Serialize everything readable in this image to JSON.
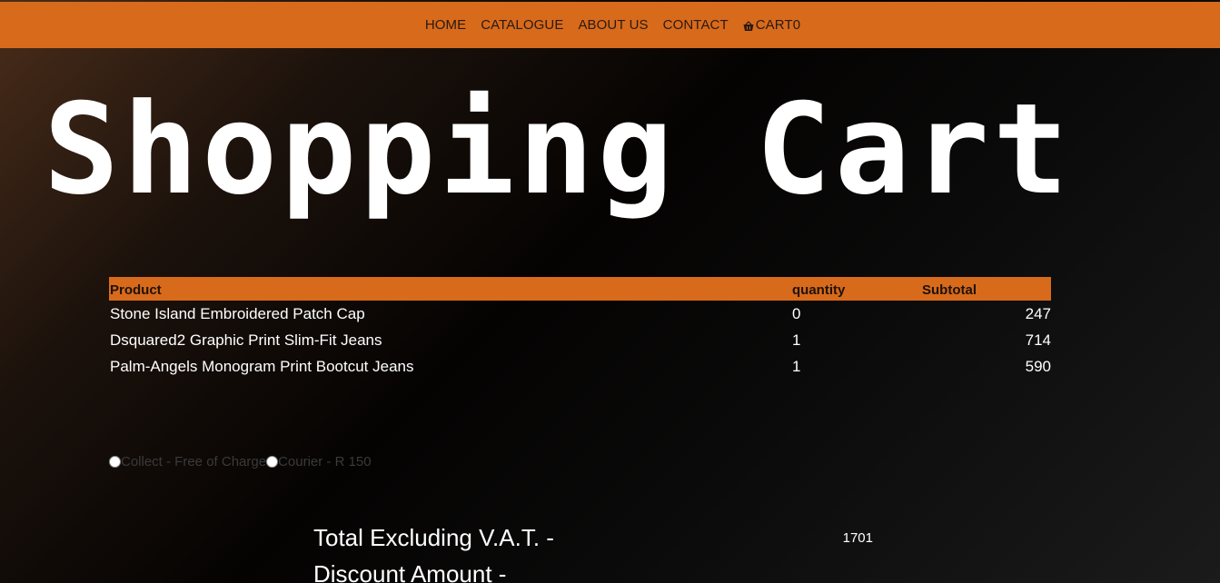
{
  "nav": {
    "items": [
      {
        "label": "HOME"
      },
      {
        "label": "CATALOGUE"
      },
      {
        "label": "ABOUT US"
      },
      {
        "label": "CONTACT"
      }
    ],
    "cart_label": "CART0",
    "cart_icon": "basket-icon"
  },
  "page": {
    "title": "Shopping Cart"
  },
  "table": {
    "headers": {
      "product": "Product",
      "quantity": "quantity",
      "subtotal": "Subtotal"
    },
    "rows": [
      {
        "product": "Stone Island Embroidered Patch Cap",
        "quantity": "0",
        "subtotal": "247"
      },
      {
        "product": "Dsquared2 Graphic Print Slim-Fit Jeans",
        "quantity": "1",
        "subtotal": "714"
      },
      {
        "product": "Palm-Angels Monogram Print Bootcut Jeans",
        "quantity": "1",
        "subtotal": "590"
      }
    ]
  },
  "delivery": {
    "options": [
      {
        "label": "Collect - Free of Charge"
      },
      {
        "label": "Courier - R 150"
      }
    ]
  },
  "totals": {
    "excl_vat_label": "Total Excluding V.A.T. -",
    "excl_vat_value": "1701",
    "discount_label": "Discount Amount -"
  },
  "colors": {
    "accent": "#d86a1c",
    "text": "#ffffff"
  }
}
